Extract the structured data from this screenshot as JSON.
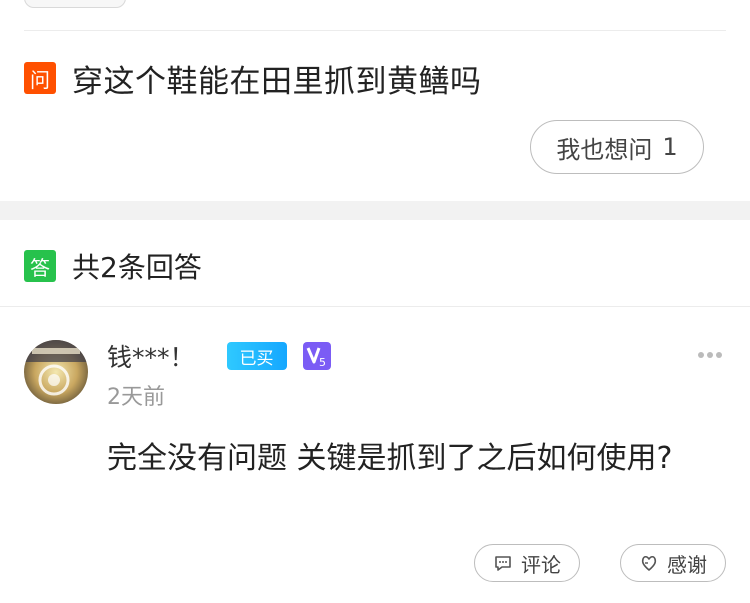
{
  "question": {
    "badge": "问",
    "text": "穿这个鞋能在田里抓到黄鳝吗",
    "ask_button_label": "我也想问",
    "ask_count": "1"
  },
  "answers": {
    "badge": "答",
    "count_label": "共2条回答",
    "items": [
      {
        "username": "钱***！",
        "bought_tag": "已买",
        "vip_level": "5",
        "time_ago": "2天前",
        "text": "完全没有问题 关键是抓到了之后如何使用?",
        "comment_label": "评论",
        "thanks_label": "感谢"
      }
    ]
  },
  "colors": {
    "question_badge": "#ff5000",
    "answer_badge": "#27c24c",
    "bought_tag": "#15a7ff",
    "vip_badge": "#7b5cf5"
  },
  "icons": {
    "more": "more-dots-icon",
    "comment": "comment-icon",
    "thanks": "thanks-icon",
    "vip": "vip-badge-icon"
  }
}
